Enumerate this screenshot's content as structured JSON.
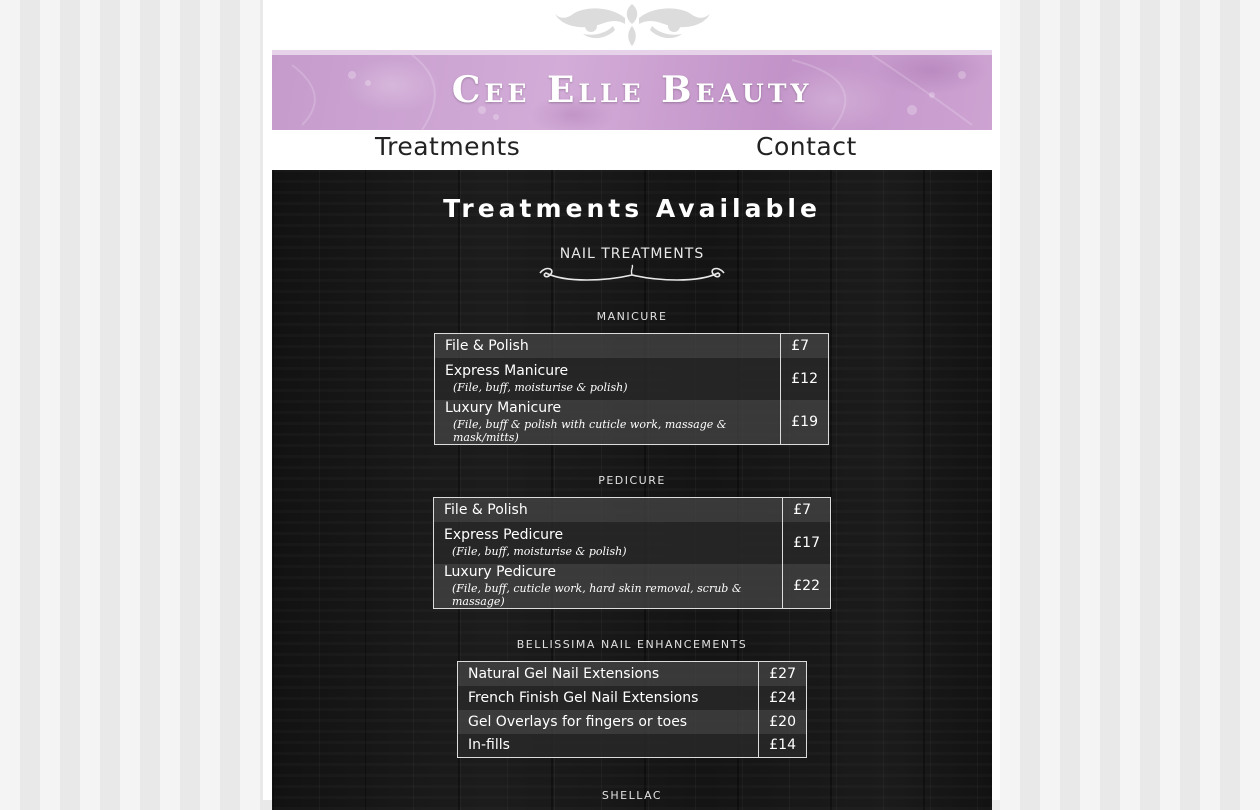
{
  "brand": "Cee Elle Beauty",
  "nav": {
    "treatments": "Treatments",
    "contact": "Contact"
  },
  "heading": "Treatments Available",
  "subheading": "NAIL TREATMENTS",
  "sections": [
    {
      "title": "MANICURE",
      "items": [
        {
          "name": "File & Polish",
          "price": "£7"
        },
        {
          "name": "Express Manicure",
          "desc": "(File, buff, moisturise & polish)",
          "price": "£12"
        },
        {
          "name": "Luxury Manicure",
          "desc": "(File, buff & polish with cuticle work, massage & mask/mitts)",
          "price": "£19"
        }
      ]
    },
    {
      "title": "PEDICURE",
      "items": [
        {
          "name": "File & Polish",
          "price": "£7"
        },
        {
          "name": "Express Pedicure",
          "desc": "(File, buff, moisturise & polish)",
          "price": "£17"
        },
        {
          "name": "Luxury Pedicure",
          "desc": "(File, buff, cuticle work, hard skin removal, scrub & massage)",
          "price": "£22"
        }
      ]
    },
    {
      "title": "BELLISSIMA NAIL ENHANCEMENTS",
      "items": [
        {
          "name": "Natural Gel Nail Extensions",
          "price": "£27"
        },
        {
          "name": "French Finish Gel Nail Extensions",
          "price": "£24"
        },
        {
          "name": "Gel Overlays for fingers or toes",
          "price": "£20"
        },
        {
          "name": "In-fills",
          "price": "£14"
        }
      ]
    },
    {
      "title": "SHELLAC"
    }
  ]
}
